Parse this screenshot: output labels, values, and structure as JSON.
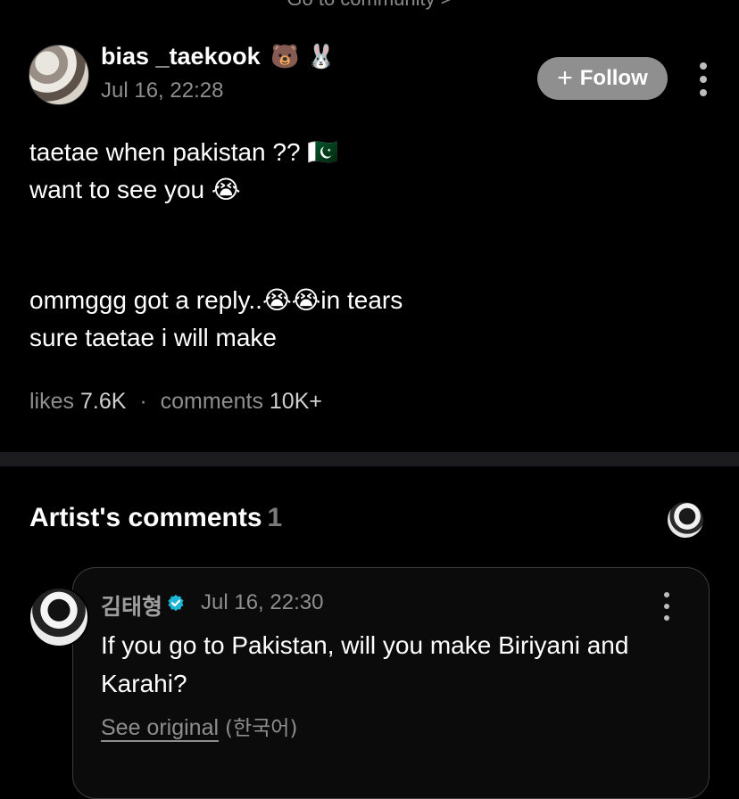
{
  "header": {
    "community_link": "Go to community >"
  },
  "post": {
    "author": {
      "name": "bias _taekook",
      "name_emoji": "🐻 🐰"
    },
    "timestamp": "Jul 16, 22:28",
    "follow_label": "Follow",
    "lines": [
      {
        "text": "taetae when pakistan ??",
        "emoji": "🇵🇰"
      },
      {
        "text": "want to see you",
        "emoji": "😭"
      },
      {
        "text": "ommggg got a reply..",
        "emoji": "😭😭",
        "after": "in tears"
      },
      {
        "text": "sure taetae i will make"
      }
    ],
    "stats": {
      "likes_label": "likes",
      "likes_value": "7.6K",
      "separator": "·",
      "comments_label": "comments",
      "comments_value": "10K+"
    }
  },
  "artist_comments": {
    "title": "Artist's comments",
    "count": "1",
    "comment": {
      "author": "김태형",
      "verified": true,
      "timestamp": "Jul 16, 22:30",
      "text": "If you go to Pakistan, will you make Biriyani and Karahi?",
      "see_original": "See original",
      "original_language": "(한국어)"
    }
  },
  "icons": {
    "plus": "plus-icon",
    "more": "more-vertical-icon",
    "verified": "verified-badge-icon"
  },
  "colors": {
    "background": "#000000",
    "follow_button": "#8f8f8f",
    "verified": "#1fb6d6",
    "muted_text": "#8e8e8e"
  }
}
